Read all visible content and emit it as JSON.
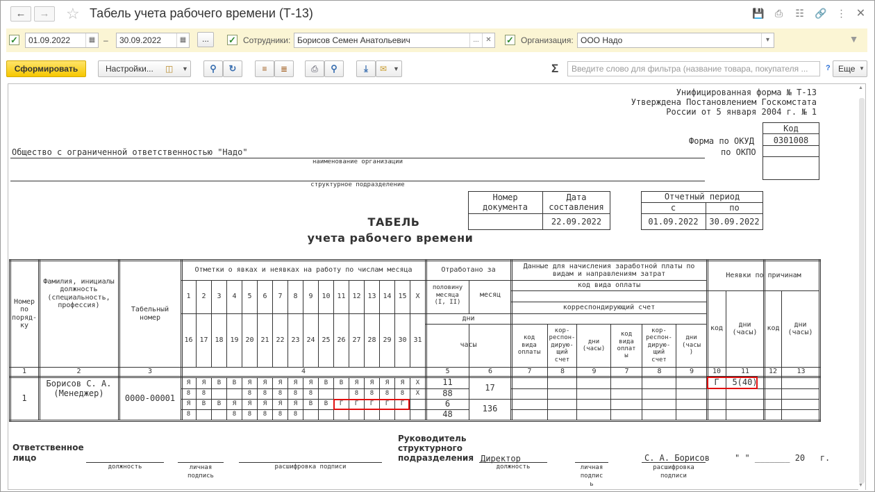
{
  "window": {
    "title": "Табель учета рабочего времени (Т-13)"
  },
  "filters": {
    "date_from": "01.09.2022",
    "dash": "–",
    "date_to": "30.09.2022",
    "more_btn": "...",
    "employees_label": "Сотрудники:",
    "employees_value": "Борисов Семен Анатольевич",
    "org_label": "Организация:",
    "org_value": "ООО Надо"
  },
  "toolbar": {
    "generate": "Сформировать",
    "settings": "Настройки...",
    "sigma": "Σ",
    "search_placeholder": "Введите слово для фильтра (название товара, покупателя ...",
    "help": "?",
    "more": "Еще"
  },
  "doc": {
    "form_header": [
      "Унифицированная форма № Т-13",
      "Утверждена Постановлением Госкомстата",
      "России от 5 января 2004 г. № 1"
    ],
    "code_label": "Код",
    "okud_label": "Форма по ОКУД",
    "okud_value": "0301008",
    "okpo_label": "по ОКПО",
    "org_name": "Общество с ограниченной ответственностью \"Надо\"",
    "org_caption": "наименование организации",
    "dept_caption": "структурное подразделение",
    "doc_number_label": "Номер\nдокумента",
    "doc_date_label": "Дата\nсоставления",
    "doc_date_value": "22.09.2022",
    "period_label": "Отчетный период",
    "period_from_label": "с",
    "period_to_label": "по",
    "period_from": "01.09.2022",
    "period_to": "30.09.2022",
    "title1": "ТАБЕЛЬ",
    "title2": "учета  рабочего времени"
  },
  "table": {
    "h_num": "Номер\nпо\nпоряд-\nку",
    "h_name": "Фамилия, инициалы\nдолжность\n(специальность,\nпрофессия)",
    "h_tab": "Табельный\nномер",
    "h_marks": "Отметки о явках и неявках на работу по числам месяца",
    "h_worked": "Отработано за",
    "h_half": "половину\nмесяца\n(I, II)",
    "h_month": "месяц",
    "h_days": "дни",
    "h_hours": "часы",
    "h_pay": "Данные для начисления заработной платы по\nвидам и направлениям затрат",
    "h_paycode": "код вида оплаты",
    "h_corr": "корреспондирующий счет",
    "h_sub_code": "код\nвида\nоплаты",
    "h_sub_corr": "кор-\nреспон-\nдирую-\nщий\nсчет",
    "h_sub_days": "дни\n(часы)",
    "h_sub_days2": "дни\n(часы\n)",
    "h_sub_code2": "код\nвида\nоплат\nы",
    "h_absence": "Неявки по причинам",
    "h_abs_code": "код",
    "h_abs_days": "дни\n(часы)",
    "days_row1": [
      "1",
      "2",
      "3",
      "4",
      "5",
      "6",
      "7",
      "8",
      "9",
      "10",
      "11",
      "12",
      "13",
      "14",
      "15",
      "Х"
    ],
    "days_row2": [
      "16",
      "17",
      "18",
      "19",
      "20",
      "21",
      "22",
      "23",
      "24",
      "25",
      "26",
      "27",
      "28",
      "29",
      "30",
      "31"
    ],
    "col_numbers": [
      "1",
      "2",
      "3",
      "4",
      "5",
      "6",
      "7",
      "8",
      "9",
      "7",
      "8",
      "9",
      "10",
      "11",
      "12",
      "13"
    ],
    "row": {
      "num": "1",
      "name": "Борисов С. А.\n(Менеджер)",
      "tab": "0000-00001",
      "marks1": [
        "Я",
        "Я",
        "В",
        "В",
        "Я",
        "Я",
        "Я",
        "Я",
        "Я",
        "В",
        "В",
        "Я",
        "Я",
        "Я",
        "Я",
        "Х"
      ],
      "hours1": [
        "8",
        "8",
        "",
        "",
        "8",
        "8",
        "8",
        "8",
        "8",
        "",
        "",
        "8",
        "8",
        "8",
        "8",
        "Х"
      ],
      "marks2": [
        "Я",
        "В",
        "В",
        "Я",
        "Я",
        "Я",
        "Я",
        "Я",
        "В",
        "В",
        "Г",
        "Г",
        "Г",
        "Г",
        "Г",
        ""
      ],
      "hours2": [
        "8",
        "",
        "",
        "8",
        "8",
        "8",
        "8",
        "8",
        "",
        "",
        "",
        "",
        "",
        "",
        "",
        ""
      ],
      "half1_days": "11",
      "half1_hours": "88",
      "half2_days": "6",
      "half2_hours": "48",
      "month_days": "17",
      "month_hours": "136",
      "abs_code": "Г",
      "abs_days": "5(40)"
    }
  },
  "signatures": {
    "resp_label": "Ответственное\nлицо",
    "position_cap": "должность",
    "sign_cap": "личная\nподпись",
    "decode_cap": "расшифровка подписи",
    "head_label": "Руководитель\nструктурного\nподразделения",
    "director": "Директор",
    "sign_cap2": "личная\nподпис\nь",
    "decode_cap2": "расшифровка\nподписи",
    "head_name": "С. А. Борисов",
    "date_line": "\" \" _______ 20   г."
  }
}
